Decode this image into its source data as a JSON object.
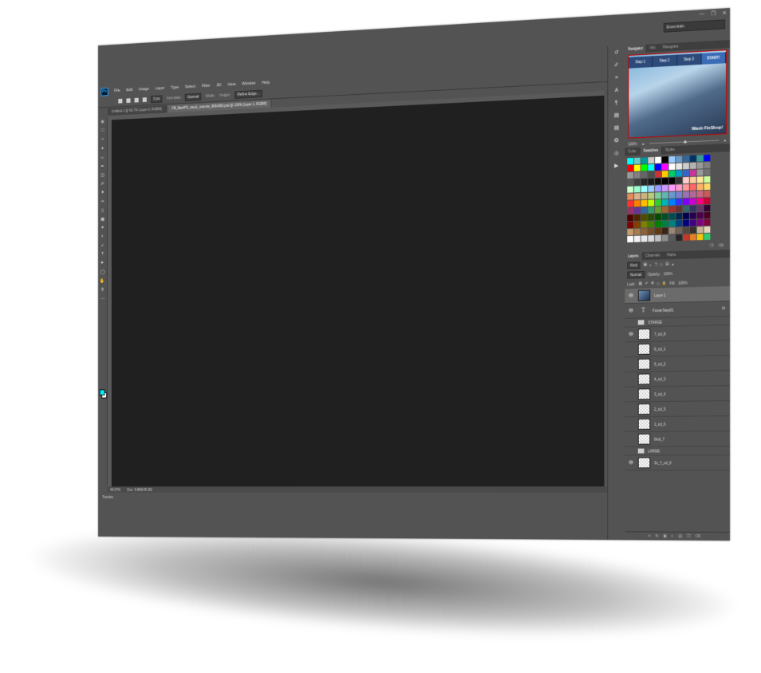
{
  "workspace": "Essentials",
  "menu": [
    "File",
    "Edit",
    "Image",
    "Layer",
    "Type",
    "Select",
    "Filter",
    "3D",
    "View",
    "Window",
    "Help"
  ],
  "options": {
    "feather": "0 px",
    "antialias": "Anti-alias",
    "style": "Normal",
    "width": "Width:",
    "height": "Height:",
    "refine": "Refine Edge..."
  },
  "tabs": [
    {
      "label": "Untitled-1 @ 66.7% (Layer 0, RGB/8)",
      "active": false
    },
    {
      "label": "FB_flashPS_step1_snsnzix_960x960.psd @ 100% (Layer 1, RGB/8)",
      "active": true
    }
  ],
  "status": {
    "zoom": "66.67%",
    "doc": "Doc: 5.88M/45.3M"
  },
  "timeline_label": "Timeline",
  "colors": {
    "foreground": "#00f0ff",
    "background": "#ffffff"
  },
  "navigator": {
    "tabs": [
      "Navigator",
      "Info",
      "Histogram"
    ],
    "steps": [
      "Step 1",
      "Step 2",
      "Step 3",
      "START!"
    ],
    "logo": "Wash FinShop!",
    "zoom": "100%"
  },
  "swatches": {
    "tabs": [
      "Color",
      "Swatches",
      "Styles"
    ],
    "colors": [
      "#00ffff",
      "#66cccc",
      "#009999",
      "#cccccc",
      "#ffffff",
      "#000000",
      "#99ccff",
      "#6699cc",
      "#336699",
      "#003366",
      "#339999",
      "#0000ff",
      "#ff0000",
      "#ffff00",
      "#00ff00",
      "#00ffff",
      "#0000ff",
      "#ff00ff",
      "#ffffff",
      "#e6e6e6",
      "#cccccc",
      "#b3b3b3",
      "#999999",
      "#808080",
      "#999999",
      "#808080",
      "#666666",
      "#4d4d4d",
      "#cc3333",
      "#ffcc00",
      "#00cc66",
      "#0099cc",
      "#3366cc",
      "#cc3399",
      "#999999",
      "#737373",
      "#595959",
      "#404040",
      "#262626",
      "#1a1a1a",
      "#0d0d0d",
      "#000000",
      "#000000",
      "#333333",
      "#ffcccc",
      "#ffcc99",
      "#ffe699",
      "#ccff99",
      "#ccffcc",
      "#99ffcc",
      "#99ffff",
      "#99ccff",
      "#9999ff",
      "#cc99ff",
      "#ff99ff",
      "#ff99cc",
      "#ff9999",
      "#ff6666",
      "#ffb366",
      "#ffd966",
      "#e68a5c",
      "#d9b38c",
      "#ccb37a",
      "#b3cc7a",
      "#80cc99",
      "#66b3b3",
      "#6699cc",
      "#7a80cc",
      "#9973b3",
      "#b36699",
      "#cc6680",
      "#cc5959",
      "#ff3333",
      "#ff8000",
      "#ffbf00",
      "#bfff00",
      "#33cc33",
      "#00b3b3",
      "#0080ff",
      "#3333ff",
      "#8000ff",
      "#cc00cc",
      "#ff0080",
      "#cc0033",
      "#993366",
      "#663399",
      "#336699",
      "#339966",
      "#669933",
      "#996633",
      "#993333",
      "#663333",
      "#336666",
      "#333366",
      "#663366",
      "#330033",
      "#4d0000",
      "#4d2600",
      "#4d4d00",
      "#264d00",
      "#004d00",
      "#004d26",
      "#004d4d",
      "#00264d",
      "#00004d",
      "#26004d",
      "#4d004d",
      "#4d0026",
      "#800000",
      "#804000",
      "#808000",
      "#408000",
      "#008000",
      "#008040",
      "#008080",
      "#004080",
      "#000080",
      "#400080",
      "#800080",
      "#800040",
      "#c69c6d",
      "#a67c52",
      "#8c6239",
      "#754c24",
      "#603913",
      "#3c2415",
      "#998675",
      "#736357",
      "#534741",
      "#362f2d",
      "#c7b299",
      "#e6d4b8",
      "#ffffff",
      "#f2f2f2",
      "#e6e6e6",
      "#d9d9d9",
      "#bfbfbf",
      "#8c8c8c",
      "#595959",
      "#262626",
      "#c0392b",
      "#e67e22",
      "#f1c40f",
      "#2ecc71"
    ]
  },
  "layers": {
    "tabs": [
      "Layers",
      "Channels",
      "Paths"
    ],
    "filter": "Kind",
    "blend": "Normal",
    "opacity_label": "Opacity:",
    "opacity": "100%",
    "lock_label": "Lock:",
    "fill_label": "Fill:",
    "fill": "100%",
    "items": [
      {
        "name": "Layer 1",
        "type": "image",
        "visible": true,
        "selected": true
      },
      {
        "name": "FosterStep01",
        "type": "text",
        "visible": true,
        "fx": "fx"
      },
      {
        "name": "STARGE",
        "type": "group",
        "visible": false
      },
      {
        "name": "7_cd_8",
        "type": "layer",
        "visible": true
      },
      {
        "name": "6_cd_1",
        "type": "layer",
        "visible": false
      },
      {
        "name": "5_cd_2",
        "type": "layer",
        "visible": false
      },
      {
        "name": "4_cd_3",
        "type": "layer",
        "visible": false
      },
      {
        "name": "3_cd_4",
        "type": "layer",
        "visible": false
      },
      {
        "name": "2_cd_5",
        "type": "layer",
        "visible": false
      },
      {
        "name": "1_cd_6",
        "type": "layer",
        "visible": false
      },
      {
        "name": "0icd_7",
        "type": "layer",
        "visible": false
      },
      {
        "name": "LARGE",
        "type": "group",
        "visible": false
      },
      {
        "name": "3x_7_cd_0",
        "type": "layer",
        "visible": true
      }
    ]
  }
}
